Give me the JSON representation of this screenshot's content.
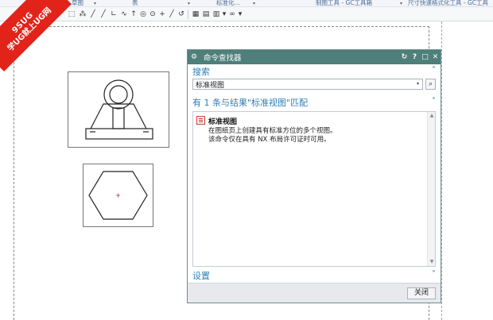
{
  "ribbon_groups": [
    {
      "label": "注释"
    },
    {
      "label": "草图"
    },
    {
      "label": "表"
    },
    {
      "label": "标准化..."
    },
    {
      "label": "制图工具 - GC工具箱"
    },
    {
      "label": "尺寸快速格式化工具 - GC工具"
    }
  ],
  "watermark": {
    "line1": "9SUG",
    "line2": "学UG就上UG网"
  },
  "dialog": {
    "title": "命令查找器",
    "search": {
      "heading": "搜索",
      "value": "标准视图",
      "search_icon": "magnifier-icon"
    },
    "results": {
      "heading": "有 1 条与结果\"标准视图\"匹配",
      "items": [
        {
          "title": "标准视图",
          "desc_line1": "在图纸页上创建具有标准方位的多个视图。",
          "desc_line2": "该命令仅在具有 NX 布局许可证时可用。"
        }
      ]
    },
    "settings": {
      "heading": "设置"
    },
    "close_label": "关闭"
  }
}
